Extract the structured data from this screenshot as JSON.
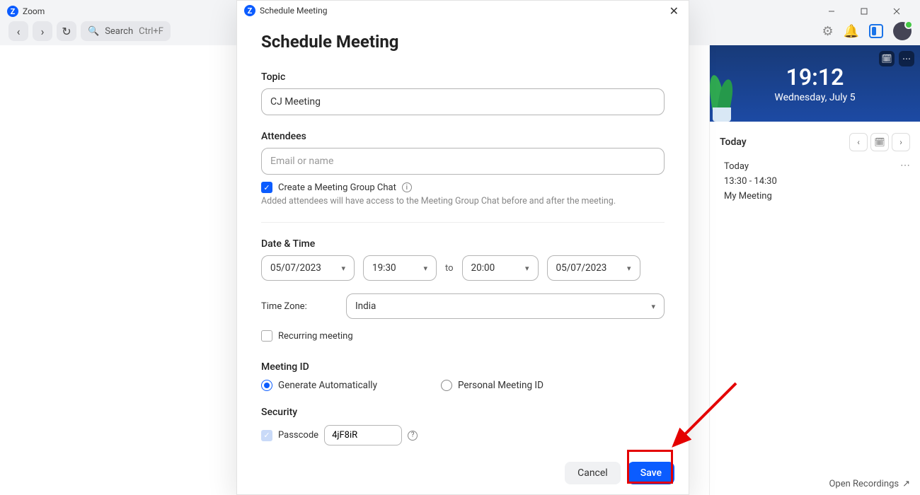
{
  "app": {
    "name": "Zoom"
  },
  "window_controls": {
    "min": "minimize",
    "max": "maximize",
    "close": "close"
  },
  "toolbar": {
    "search_label": "Search",
    "search_shortcut": "Ctrl+F"
  },
  "hero": {
    "time": "19:12",
    "date": "Wednesday, July 5"
  },
  "sidebar": {
    "today_label": "Today",
    "event": {
      "day": "Today",
      "time": "13:30 - 14:30",
      "title": "My Meeting"
    }
  },
  "open_recordings": "Open Recordings",
  "dialog": {
    "window_title": "Schedule Meeting",
    "heading": "Schedule Meeting",
    "topic_label": "Topic",
    "topic_value": "CJ Meeting",
    "attendees_label": "Attendees",
    "attendees_placeholder": "Email or name",
    "group_chat_label": "Create a Meeting Group Chat",
    "group_chat_helper": "Added attendees will have access to the Meeting Group Chat before and after the meeting.",
    "datetime_label": "Date & Time",
    "date_start": "05/07/2023",
    "time_start": "19:30",
    "to_label": "to",
    "time_end": "20:00",
    "date_end": "05/07/2023",
    "tz_label": "Time Zone:",
    "tz_value": "India",
    "recurring_label": "Recurring meeting",
    "meeting_id_label": "Meeting ID",
    "mid_generate": "Generate Automatically",
    "mid_personal": "Personal Meeting ID",
    "security_label": "Security",
    "passcode_label": "Passcode",
    "passcode_value": "4jF8iR",
    "cancel": "Cancel",
    "save": "Save"
  }
}
